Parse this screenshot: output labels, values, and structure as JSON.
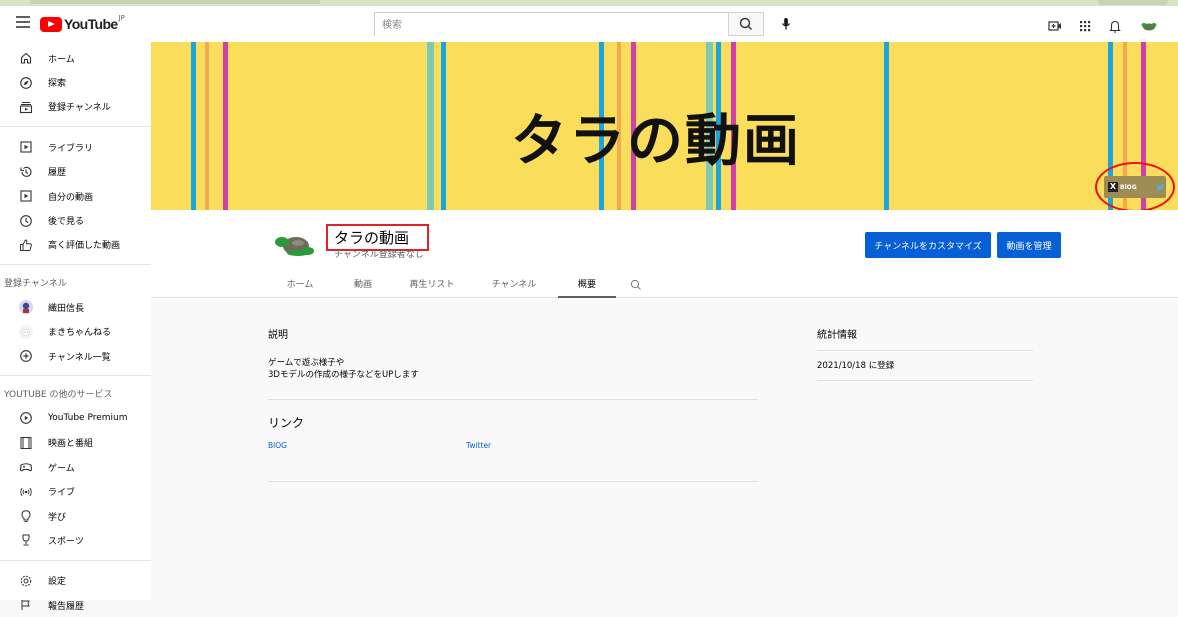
{
  "masthead": {
    "logo_text": "YouTube",
    "logo_region": "JP",
    "search_placeholder": "検索"
  },
  "sidebar": {
    "main": [
      {
        "label": "ホーム",
        "icon": "home-icon"
      },
      {
        "label": "探索",
        "icon": "explore-icon"
      },
      {
        "label": "登録チャンネル",
        "icon": "subscriptions-icon"
      }
    ],
    "library": [
      {
        "label": "ライブラリ",
        "icon": "library-icon"
      },
      {
        "label": "履歴",
        "icon": "history-icon"
      },
      {
        "label": "自分の動画",
        "icon": "your-videos-icon"
      },
      {
        "label": "後で見る",
        "icon": "watch-later-icon"
      },
      {
        "label": "高く評価した動画",
        "icon": "liked-videos-icon"
      }
    ],
    "subscriptions_header": "登録チャンネル",
    "subscriptions": [
      {
        "label": "織田信長",
        "icon": "channel-avatar-icon"
      },
      {
        "label": "まきちゃんねる",
        "icon": "channel-avatar-icon"
      },
      {
        "label": "チャンネル一覧",
        "icon": "browse-channels-icon"
      }
    ],
    "more_header": "YOUTUBE の他のサービス",
    "more": [
      {
        "label": "YouTube Premium",
        "icon": "youtube-premium-icon"
      },
      {
        "label": "映画と番組",
        "icon": "movies-icon"
      },
      {
        "label": "ゲーム",
        "icon": "gaming-icon"
      },
      {
        "label": "ライブ",
        "icon": "live-icon"
      },
      {
        "label": "学び",
        "icon": "learning-icon"
      },
      {
        "label": "スポーツ",
        "icon": "sports-icon"
      }
    ],
    "settings": [
      {
        "label": "設定",
        "icon": "settings-icon"
      },
      {
        "label": "報告履歴",
        "icon": "report-history-icon"
      }
    ]
  },
  "banner": {
    "title": "タラの動画",
    "links_label": "BlOG",
    "colors": {
      "background": "#fbdd5c",
      "stripe_cyan": "#1aa6dd",
      "stripe_magenta": "#d23fa8",
      "stripe_orange": "#f5a94e",
      "stripe_teal": "#7ec8b6"
    }
  },
  "channel": {
    "name": "タラの動画",
    "subscribers": "チャンネル登録者なし",
    "customize_button": "チャンネルをカスタマイズ",
    "manage_button": "動画を管理",
    "tabs": [
      "ホーム",
      "動画",
      "再生リスト",
      "チャンネル",
      "概要"
    ],
    "active_tab": "概要"
  },
  "about": {
    "description_title": "説明",
    "description_line1": "ゲームで遊ぶ様子や",
    "description_line2": "3Dモデルの作成の様子などをUPします",
    "links_title": "リンク",
    "links": [
      "BlOG",
      "Twitter"
    ],
    "stats_title": "統計情報",
    "joined": "2021/10/18 に登録"
  },
  "accent_color": "#065fd4",
  "highlight_color": "#e0222d"
}
